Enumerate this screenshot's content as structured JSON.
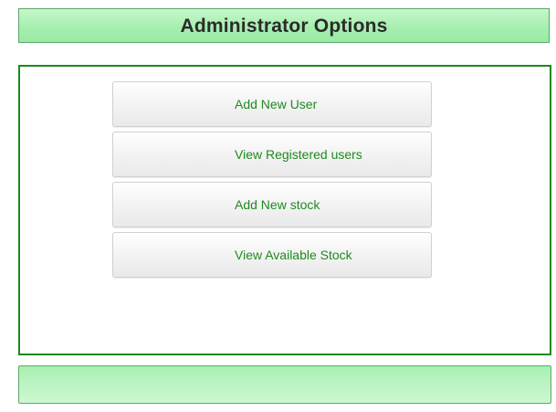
{
  "header": {
    "title": "Administrator Options"
  },
  "menu": {
    "items": [
      {
        "label": "Add New User"
      },
      {
        "label": "View Registered users"
      },
      {
        "label": "Add New stock"
      },
      {
        "label": "View Available Stock"
      }
    ]
  },
  "colors": {
    "header_bg": "#a6efaf",
    "panel_border": "#1d8a1d",
    "link_text": "#1f8a1f",
    "title_text": "#2b2b2b"
  }
}
